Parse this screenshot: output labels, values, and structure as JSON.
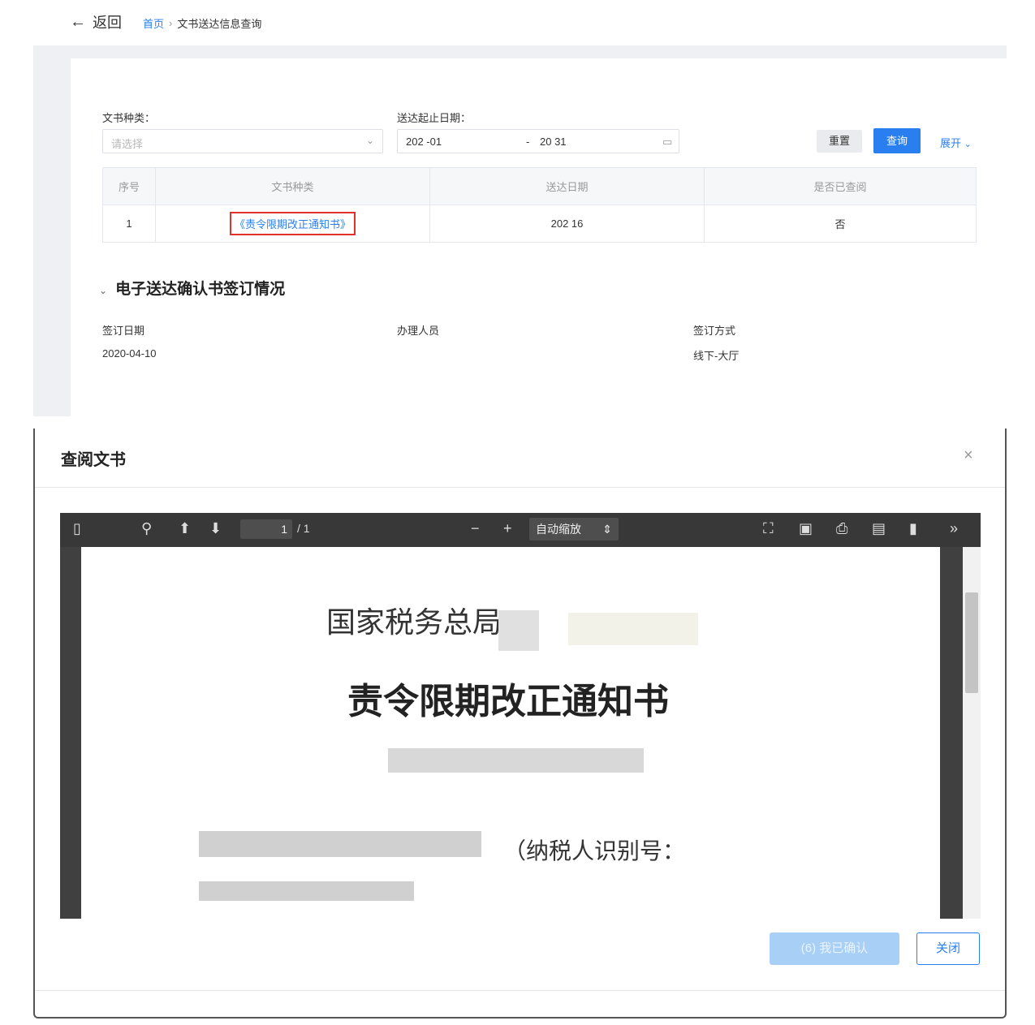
{
  "header": {
    "back_label": "返回",
    "breadcrumb_home": "首页",
    "breadcrumb_separator": "›",
    "breadcrumb_current": "文书送达信息查询"
  },
  "filters": {
    "doc_type_label": "文书种类：",
    "doc_type_placeholder": "请选择",
    "date_range_label": "送达起止日期：",
    "date_start": "202 -01",
    "date_separator": "-",
    "date_end": "20 31",
    "reset_label": "重置",
    "query_label": "查询",
    "expand_label": "展开"
  },
  "table": {
    "columns": [
      "序号",
      "文书种类",
      "送达日期",
      "是否已查阅"
    ],
    "rows": [
      {
        "index": "1",
        "doc_type": "《责令限期改正通知书》",
        "date": "202 16",
        "viewed": "否"
      }
    ]
  },
  "confirmation": {
    "section_title": "电子送达确认书签订情况",
    "sign_date_label": "签订日期",
    "sign_date_value": "2020-04-10",
    "handler_label": "办理人员",
    "handler_value": "",
    "method_label": "签订方式",
    "method_value": "线下-大厅"
  },
  "modal": {
    "title": "查阅文书",
    "close_symbol": "×",
    "viewer": {
      "page_current": "1",
      "page_total": "/ 1",
      "zoom_label": "自动缩放"
    },
    "document": {
      "org_name": "国家税务总局",
      "title": "责令限期改正通知书",
      "taxpayer_line": "（纳税人识别号："
    },
    "confirm_label": "(6) 我已确认",
    "close_label": "关闭"
  },
  "colors": {
    "accent": "#2a7ff0",
    "highlight_border": "#e0322b"
  }
}
